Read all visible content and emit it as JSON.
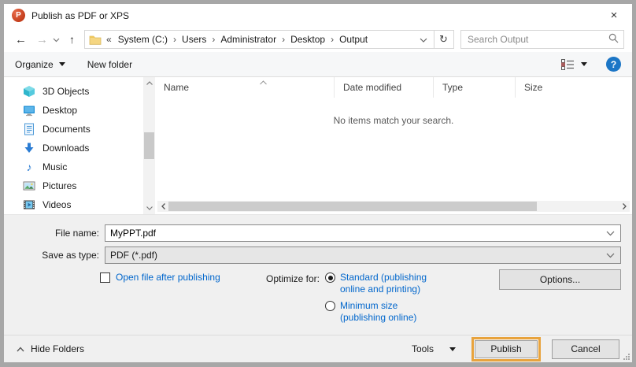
{
  "window": {
    "title": "Publish as PDF or XPS"
  },
  "icons": {
    "ppt": "P",
    "close": "×",
    "back": "←",
    "forward": "→",
    "up": "↑",
    "refresh": "↻",
    "help": "?",
    "music_note": "♪",
    "breadcrumb_overflow": "«",
    "breadcrumb_sep": "›"
  },
  "nav": {
    "breadcrumb": [
      "System (C:)",
      "Users",
      "Administrator",
      "Desktop",
      "Output"
    ],
    "search_placeholder": "Search Output"
  },
  "toolbar": {
    "organize": "Organize",
    "new_folder": "New folder"
  },
  "sidebar": {
    "items": [
      {
        "label": "3D Objects",
        "icon": "3d-objects-icon"
      },
      {
        "label": "Desktop",
        "icon": "desktop-icon"
      },
      {
        "label": "Documents",
        "icon": "documents-icon"
      },
      {
        "label": "Downloads",
        "icon": "downloads-icon"
      },
      {
        "label": "Music",
        "icon": "music-icon"
      },
      {
        "label": "Pictures",
        "icon": "pictures-icon"
      },
      {
        "label": "Videos",
        "icon": "videos-icon"
      }
    ]
  },
  "filelist": {
    "columns": [
      "Name",
      "Date modified",
      "Type",
      "Size"
    ],
    "empty_message": "No items match your search."
  },
  "form": {
    "file_name_label": "File name:",
    "file_name_value": "MyPPT.pdf",
    "save_type_label": "Save as type:",
    "save_type_value": "PDF (*.pdf)",
    "open_after_label": "Open file after publishing",
    "optimize_label": "Optimize for:",
    "radio_standard_line1": "Standard (publishing",
    "radio_standard_line2": "online and printing)",
    "radio_standard_state": "selected",
    "radio_min_line1": "Minimum size",
    "radio_min_line2": "(publishing online)",
    "radio_min_state": "unselected",
    "open_after_state": "unchecked",
    "options_button": "Options..."
  },
  "footer": {
    "hide_folders": "Hide Folders",
    "tools": "Tools",
    "publish": "Publish",
    "cancel": "Cancel"
  },
  "colors": {
    "link_blue": "#0066cc",
    "publish_highlight_orange": "#e8a33d",
    "help_blue": "#1c76c6",
    "ppt_red": "#c43e1c"
  }
}
